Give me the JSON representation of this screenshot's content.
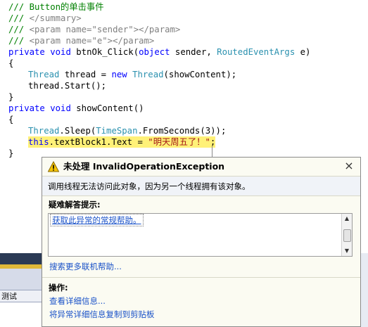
{
  "code": {
    "line1": {
      "comment": "/// ",
      "text": "Button的单击事件"
    },
    "line2": {
      "comment": "/// ",
      "tag": "</summary>"
    },
    "line3": {
      "comment": "/// ",
      "tag": "<param name=\"sender\"></param>"
    },
    "line4": {
      "comment": "/// ",
      "tag": "<param name=\"e\"></param>"
    },
    "line5": {
      "kw1": "private",
      "kw2": "void",
      "name": " btnOk_Click(",
      "kw3": "object",
      "mid": " sender, ",
      "type": "RoutedEventArgs",
      "tail": " e)"
    },
    "line6": "{",
    "line7": {
      "type1": "Thread",
      "mid": " thread = ",
      "kw": "new",
      "type2": "Thread",
      "tail": "(showContent);"
    },
    "line8": "thread.Start();",
    "line9": "}",
    "line10": {
      "kw1": "private",
      "kw2": "void",
      "name": " showContent()"
    },
    "line11": "{",
    "line12": {
      "type1": "Thread",
      "mid1": ".Sleep(",
      "type2": "TimeSpan",
      "tail": ".FromSeconds(3));"
    },
    "line13": {
      "kw": "this",
      "mid": ".textBlock1.Text = ",
      "str": "\"明天周五了！\"",
      "tail": ";"
    },
    "line14": "}"
  },
  "bottom_tab_label": "测试",
  "popup": {
    "title": "未处理 InvalidOperationException",
    "message": "调用线程无法访问此对象，因为另一个线程拥有该对象。",
    "tips_label": "疑难解答提示:",
    "tip_link": "获取此异常的常规帮助。",
    "search_link": "搜索更多联机帮助...",
    "actions_label": "操作:",
    "action_view_details": "查看详细信息...",
    "action_copy": "将异常详细信息复制到剪贴板",
    "close_glyph": "×"
  },
  "colors": {
    "comment": "#008000",
    "keyword": "#0000ff",
    "type": "#2b91af",
    "string": "#a31515",
    "highlight": "#fff178",
    "link": "#1a52c8"
  }
}
